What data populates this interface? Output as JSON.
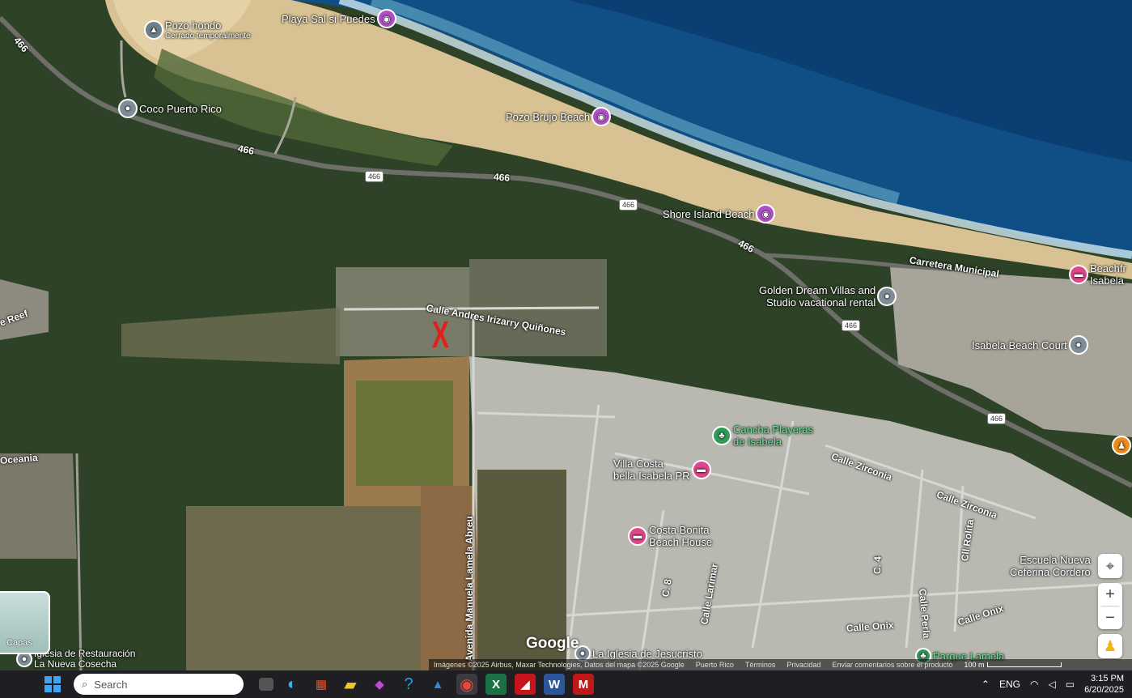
{
  "map": {
    "pois": [
      {
        "name": "Pozo hondo",
        "sub": "Cerrado temporalmente",
        "type": "tri"
      },
      {
        "name": "Playa Sal si Puedes",
        "type": "photo"
      },
      {
        "name": "Coco Puerto Rico",
        "type": "place"
      },
      {
        "name": "Pozo Brujo Beach",
        "type": "photo"
      },
      {
        "name": "Shore Island Beach",
        "type": "photo"
      },
      {
        "name": "Beachfr",
        "sub": "Isabela",
        "type": "hotel"
      },
      {
        "name": "Golden Dream Villas and",
        "sub": "Studio vacational rental",
        "type": "place"
      },
      {
        "name": "Isabela Beach Court",
        "type": "place"
      },
      {
        "name": "Cancha Playeras",
        "sub": "de Isabela",
        "type": "park"
      },
      {
        "name": "Villa Costa",
        "sub": "bella Isabela PR",
        "type": "hotel"
      },
      {
        "name": "Costa Bonita",
        "sub": "Beach House",
        "type": "hotel"
      },
      {
        "name": "Escuela Nueva",
        "sub": "Ceferina Cordero",
        "type": "place"
      },
      {
        "name": "La Iglesia de Jesucristo",
        "type": "place"
      },
      {
        "name": "Parque Lamela",
        "type": "park"
      },
      {
        "name": "Iglesia de Restauración",
        "sub": "La Nueva Cosecha",
        "type": "place"
      }
    ],
    "streets": [
      "Calle Andres Irizarry Quiñones",
      "Carretera Municipal",
      "Calle Zirconia",
      "Calle Zirconia",
      "Calle Larimar",
      "C. 8",
      "C. 4",
      "Calle Perla",
      "Cll Rolita",
      "Calle Onix",
      "Calle Onix",
      "Avenida Manuela Lamela Abreu",
      "Oceania",
      "e Reef"
    ],
    "route_number": "466",
    "marker": "X",
    "marker_color": "#e0201b"
  },
  "brand": "Google",
  "attribution": {
    "imagery": "Imágenes ©2025 Airbus, Maxar Technologies, Datos del mapa ©2025 Google",
    "country": "Puerto Rico",
    "terms": "Términos",
    "privacy": "Privacidad",
    "feedback": "Enviar comentarios sobre el producto",
    "scale": "100 m"
  },
  "controls": {
    "layers_label": "Capas",
    "zoom_in": "+",
    "zoom_out": "−"
  },
  "taskbar": {
    "search_placeholder": "Search",
    "language": "ENG",
    "time": "3:15 PM",
    "date": "6/20/2025"
  }
}
